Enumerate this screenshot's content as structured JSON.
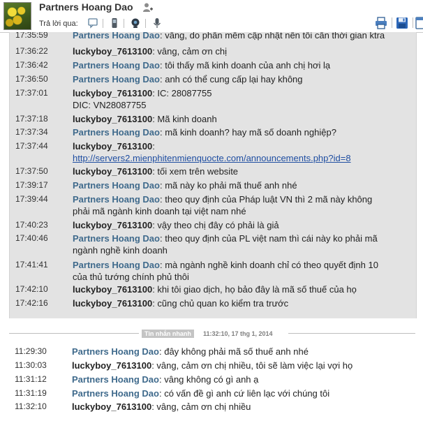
{
  "header": {
    "contact_name": "Partners Hoang Dao",
    "reply_label": "Trả lời qua:",
    "reply_icons": [
      "chat-icon",
      "phone-icon",
      "webcam-icon",
      "microphone-icon"
    ],
    "tool_icons": [
      "print-icon",
      "save-icon",
      "close-panel-icon"
    ]
  },
  "history": [
    {
      "time": "17:35:59",
      "sender": "Partners Hoang Dao",
      "role": "partner",
      "text": ": vâng, do phần mềm cập nhật nên tôi cần thời gian ktra"
    },
    {
      "time": "17:36:22",
      "sender": "luckyboy_7613100",
      "role": "me",
      "text": ": vâng, cảm ơn chị"
    },
    {
      "time": "17:36:42",
      "sender": "Partners Hoang Dao",
      "role": "partner",
      "text": ": tôi thấy mã kinh doanh của anh chị hơi lạ"
    },
    {
      "time": "17:36:50",
      "sender": "Partners Hoang Dao",
      "role": "partner",
      "text": ": anh có thể cung cấp lại hay không"
    },
    {
      "time": "17:37:01",
      "sender": "luckyboy_7613100",
      "role": "me",
      "text": ": IC: 28087755",
      "line2": "DIC: VN28087755"
    },
    {
      "time": "17:37:18",
      "sender": "luckyboy_7613100",
      "role": "me",
      "text": ": Mã kinh doanh"
    },
    {
      "time": "17:37:34",
      "sender": "Partners Hoang Dao",
      "role": "partner",
      "text": ": mã kinh doanh? hay mã số doanh nghiệp?"
    },
    {
      "time": "17:37:44",
      "sender": "luckyboy_7613100",
      "role": "me",
      "text": ":",
      "link": "http://servers2.mienphitenmienquocte.com/announcements.php?id=8"
    },
    {
      "time": "17:37:50",
      "sender": "luckyboy_7613100",
      "role": "me",
      "text": ": tối xem trên website"
    },
    {
      "time": "17:39:17",
      "sender": "Partners Hoang Dao",
      "role": "partner",
      "text": ": mã này ko phải mã thuế anh nhé"
    },
    {
      "time": "17:39:44",
      "sender": "Partners Hoang Dao",
      "role": "partner",
      "text": ": theo quy định của Pháp luật VN thì 2 mã này không",
      "line2": "phải mã ngành kinh doanh tại việt nam nhé"
    },
    {
      "time": "17:40:23",
      "sender": "luckyboy_7613100",
      "role": "me",
      "text": ": vậy theo chị đây có phải là giả"
    },
    {
      "time": "17:40:46",
      "sender": "Partners Hoang Dao",
      "role": "partner",
      "text": ": theo quy định của PL việt nam thì cái này ko phải mã",
      "line2": "ngành nghề kinh doanh"
    },
    {
      "time": "17:41:41",
      "sender": "Partners Hoang Dao",
      "role": "partner",
      "text": ": mà ngành nghề kinh doanh chỉ có theo quyết định 10",
      "line2": "của thủ tướng chính phủ thôi"
    },
    {
      "time": "17:42:10",
      "sender": "luckyboy_7613100",
      "role": "me",
      "text": ": khi tôi giao dịch, họ bảo đây là mã số thuế của họ"
    },
    {
      "time": "17:42:16",
      "sender": "luckyboy_7613100",
      "role": "me",
      "text": ": cũng chủ quan ko kiểm tra trước"
    }
  ],
  "divider": {
    "label": "Tin nhắn nhanh",
    "timestamp": "11:32:10, 17 thg 1, 2014"
  },
  "recent": [
    {
      "time": "11:29:30",
      "sender": "Partners Hoang Dao",
      "role": "partner",
      "text": ": đây không phải mã số thuế anh nhé"
    },
    {
      "time": "11:30:03",
      "sender": "luckyboy_7613100",
      "role": "me",
      "text": ": vâng, cảm ơn chị nhiều, tôi sẽ làm việc lại vợi họ"
    },
    {
      "time": "11:31:12",
      "sender": "Partners Hoang Dao",
      "role": "partner",
      "text": ": vâng không có gì anh ạ"
    },
    {
      "time": "11:31:19",
      "sender": "Partners Hoang Dao",
      "role": "partner",
      "text": ": có vấn đề gì anh cứ liên lạc với chúng tôi"
    },
    {
      "time": "11:32:10",
      "sender": "luckyboy_7613100",
      "role": "me",
      "text": ": vâng, cảm ơn chị nhiều"
    }
  ]
}
